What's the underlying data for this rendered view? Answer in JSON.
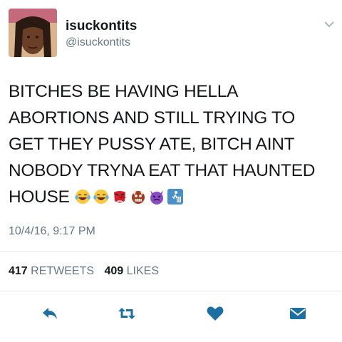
{
  "user": {
    "display_name": "isuckontits",
    "handle": "@isuckontits"
  },
  "tweet": {
    "lines": [
      "BITCHES BE HAVING HELLA",
      "ABORTIONS AND STILL TRYING TO",
      "GET THEY PUSSY ATE, BITCH AINT",
      "NOBODY TRYNA EAT THAT HAUNTED",
      "HOUSE"
    ],
    "emojis": [
      "tears-of-joy-emoji",
      "tears-of-joy-emoji",
      "tengu-emoji",
      "ogre-emoji",
      "imp-emoji",
      "wastebasket-emoji"
    ],
    "timestamp": "10/4/16, 9:17 PM"
  },
  "stats": {
    "retweets_count": "417",
    "retweets_label": "RETWEETS",
    "likes_count": "409",
    "likes_label": "LIKES"
  },
  "actions": [
    "reply-icon",
    "retweet-icon",
    "like-icon",
    "message-icon"
  ],
  "colors": {
    "text": "#14171a",
    "secondary": "#657786",
    "icon": "#1c6fa3",
    "divider": "#e1e8ed"
  }
}
